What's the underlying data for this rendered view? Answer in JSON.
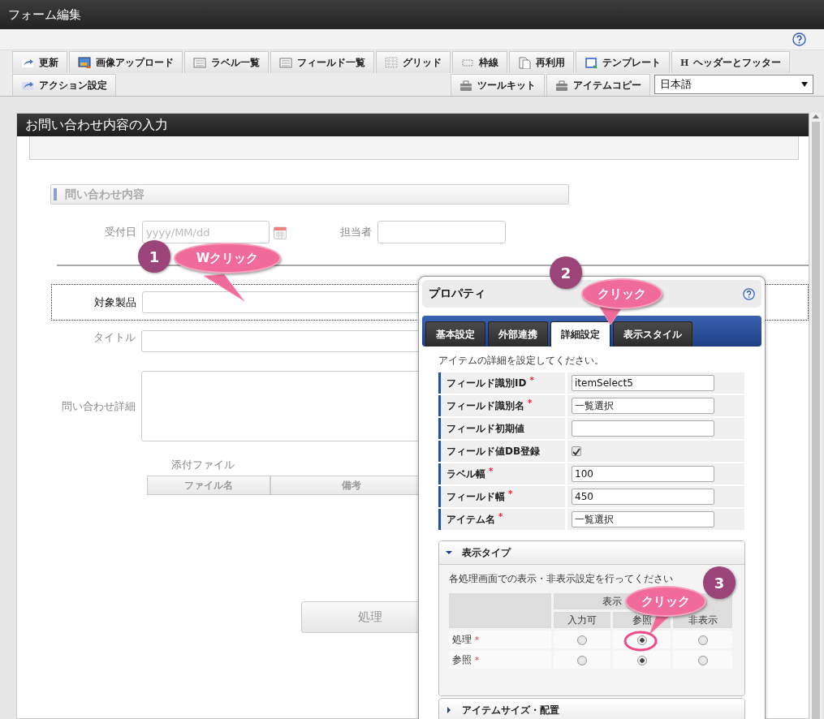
{
  "window": {
    "title": "フォーム編集"
  },
  "toolbar": {
    "row_1": [
      {
        "label": "更新"
      },
      {
        "label": "画像アップロード"
      },
      {
        "label": "ラベル一覧"
      },
      {
        "label": "フィールド一覧"
      },
      {
        "label": "グリッド"
      },
      {
        "label": "枠線"
      },
      {
        "label": "再利用"
      },
      {
        "label": "テンプレート"
      },
      {
        "label": "ヘッダーとフッター",
        "glyph": "H"
      }
    ],
    "row_2_left": [
      {
        "label": "アクション設定"
      }
    ],
    "row_2_right": [
      {
        "label": "ツールキット"
      },
      {
        "label": "アイテムコピー"
      }
    ],
    "language_select": {
      "value": "日本語"
    }
  },
  "page": {
    "title": "お問い合わせ内容の入力"
  },
  "form": {
    "section_title": "問い合わせ内容",
    "date_field": {
      "label": "受付日",
      "placeholder": "yyyy/MM/dd"
    },
    "assignee_field": {
      "label": "担当者"
    },
    "fields": [
      {
        "label": "対象製品",
        "kind": "input",
        "selected": true
      },
      {
        "label": "タイトル",
        "kind": "input",
        "selected": false
      },
      {
        "label": "問い合わせ詳細",
        "kind": "textarea",
        "selected": false
      }
    ],
    "attachments": {
      "label": "添付ファイル",
      "columns": [
        "ファイル名",
        "備考"
      ]
    },
    "submit_button": "処理"
  },
  "properties_dialog": {
    "title": "プロパティ",
    "tabs": [
      {
        "label": "基本設定",
        "selected": false
      },
      {
        "label": "外部連携",
        "selected": false
      },
      {
        "label": "詳細設定",
        "selected": true
      },
      {
        "label": "表示スタイル",
        "selected": false
      }
    ],
    "description": "アイテムの詳細を設定してください。",
    "rows": [
      {
        "label": "フィールド識別ID",
        "required_mark": "*",
        "kind": "text",
        "value": "itemSelect5"
      },
      {
        "label": "フィールド識別名",
        "required_mark": "*",
        "kind": "text",
        "value": "一覧選択"
      },
      {
        "label": "フィールド初期値",
        "kind": "text",
        "value": ""
      },
      {
        "label": "フィールド値DB登録",
        "kind": "checkbox",
        "checked": true
      },
      {
        "label": "ラベル幅",
        "required_mark": "*",
        "kind": "text",
        "value": "100"
      },
      {
        "label": "フィールド幅",
        "required_mark": "*",
        "kind": "text",
        "value": "450"
      },
      {
        "label": "アイテム名",
        "required_mark": "*",
        "kind": "text",
        "value": "一覧選択"
      }
    ],
    "sections": [
      {
        "title": "表示タイプ",
        "expanded": true,
        "description": "各処理画面での表示・非表示設定を行ってください",
        "group_header": "表示",
        "columns": [
          "入力可",
          "参照"
        ],
        "hidden_column": "非表示",
        "rows": [
          {
            "label": "処理",
            "required_mark": "*",
            "options": [
              {
                "selected": false
              },
              {
                "selected": true
              },
              {
                "selected": false
              }
            ]
          },
          {
            "label": "参照",
            "required_mark": "*",
            "options": [
              {
                "selected": false
              },
              {
                "selected": true
              },
              {
                "selected": false
              }
            ]
          }
        ]
      },
      {
        "title": "アイテムサイズ・配置",
        "expanded": false
      }
    ]
  },
  "callouts": [
    {
      "number": "1",
      "label": "Wクリック"
    },
    {
      "number": "2",
      "label": "クリック"
    },
    {
      "number": "3",
      "label": "クリック"
    }
  ]
}
